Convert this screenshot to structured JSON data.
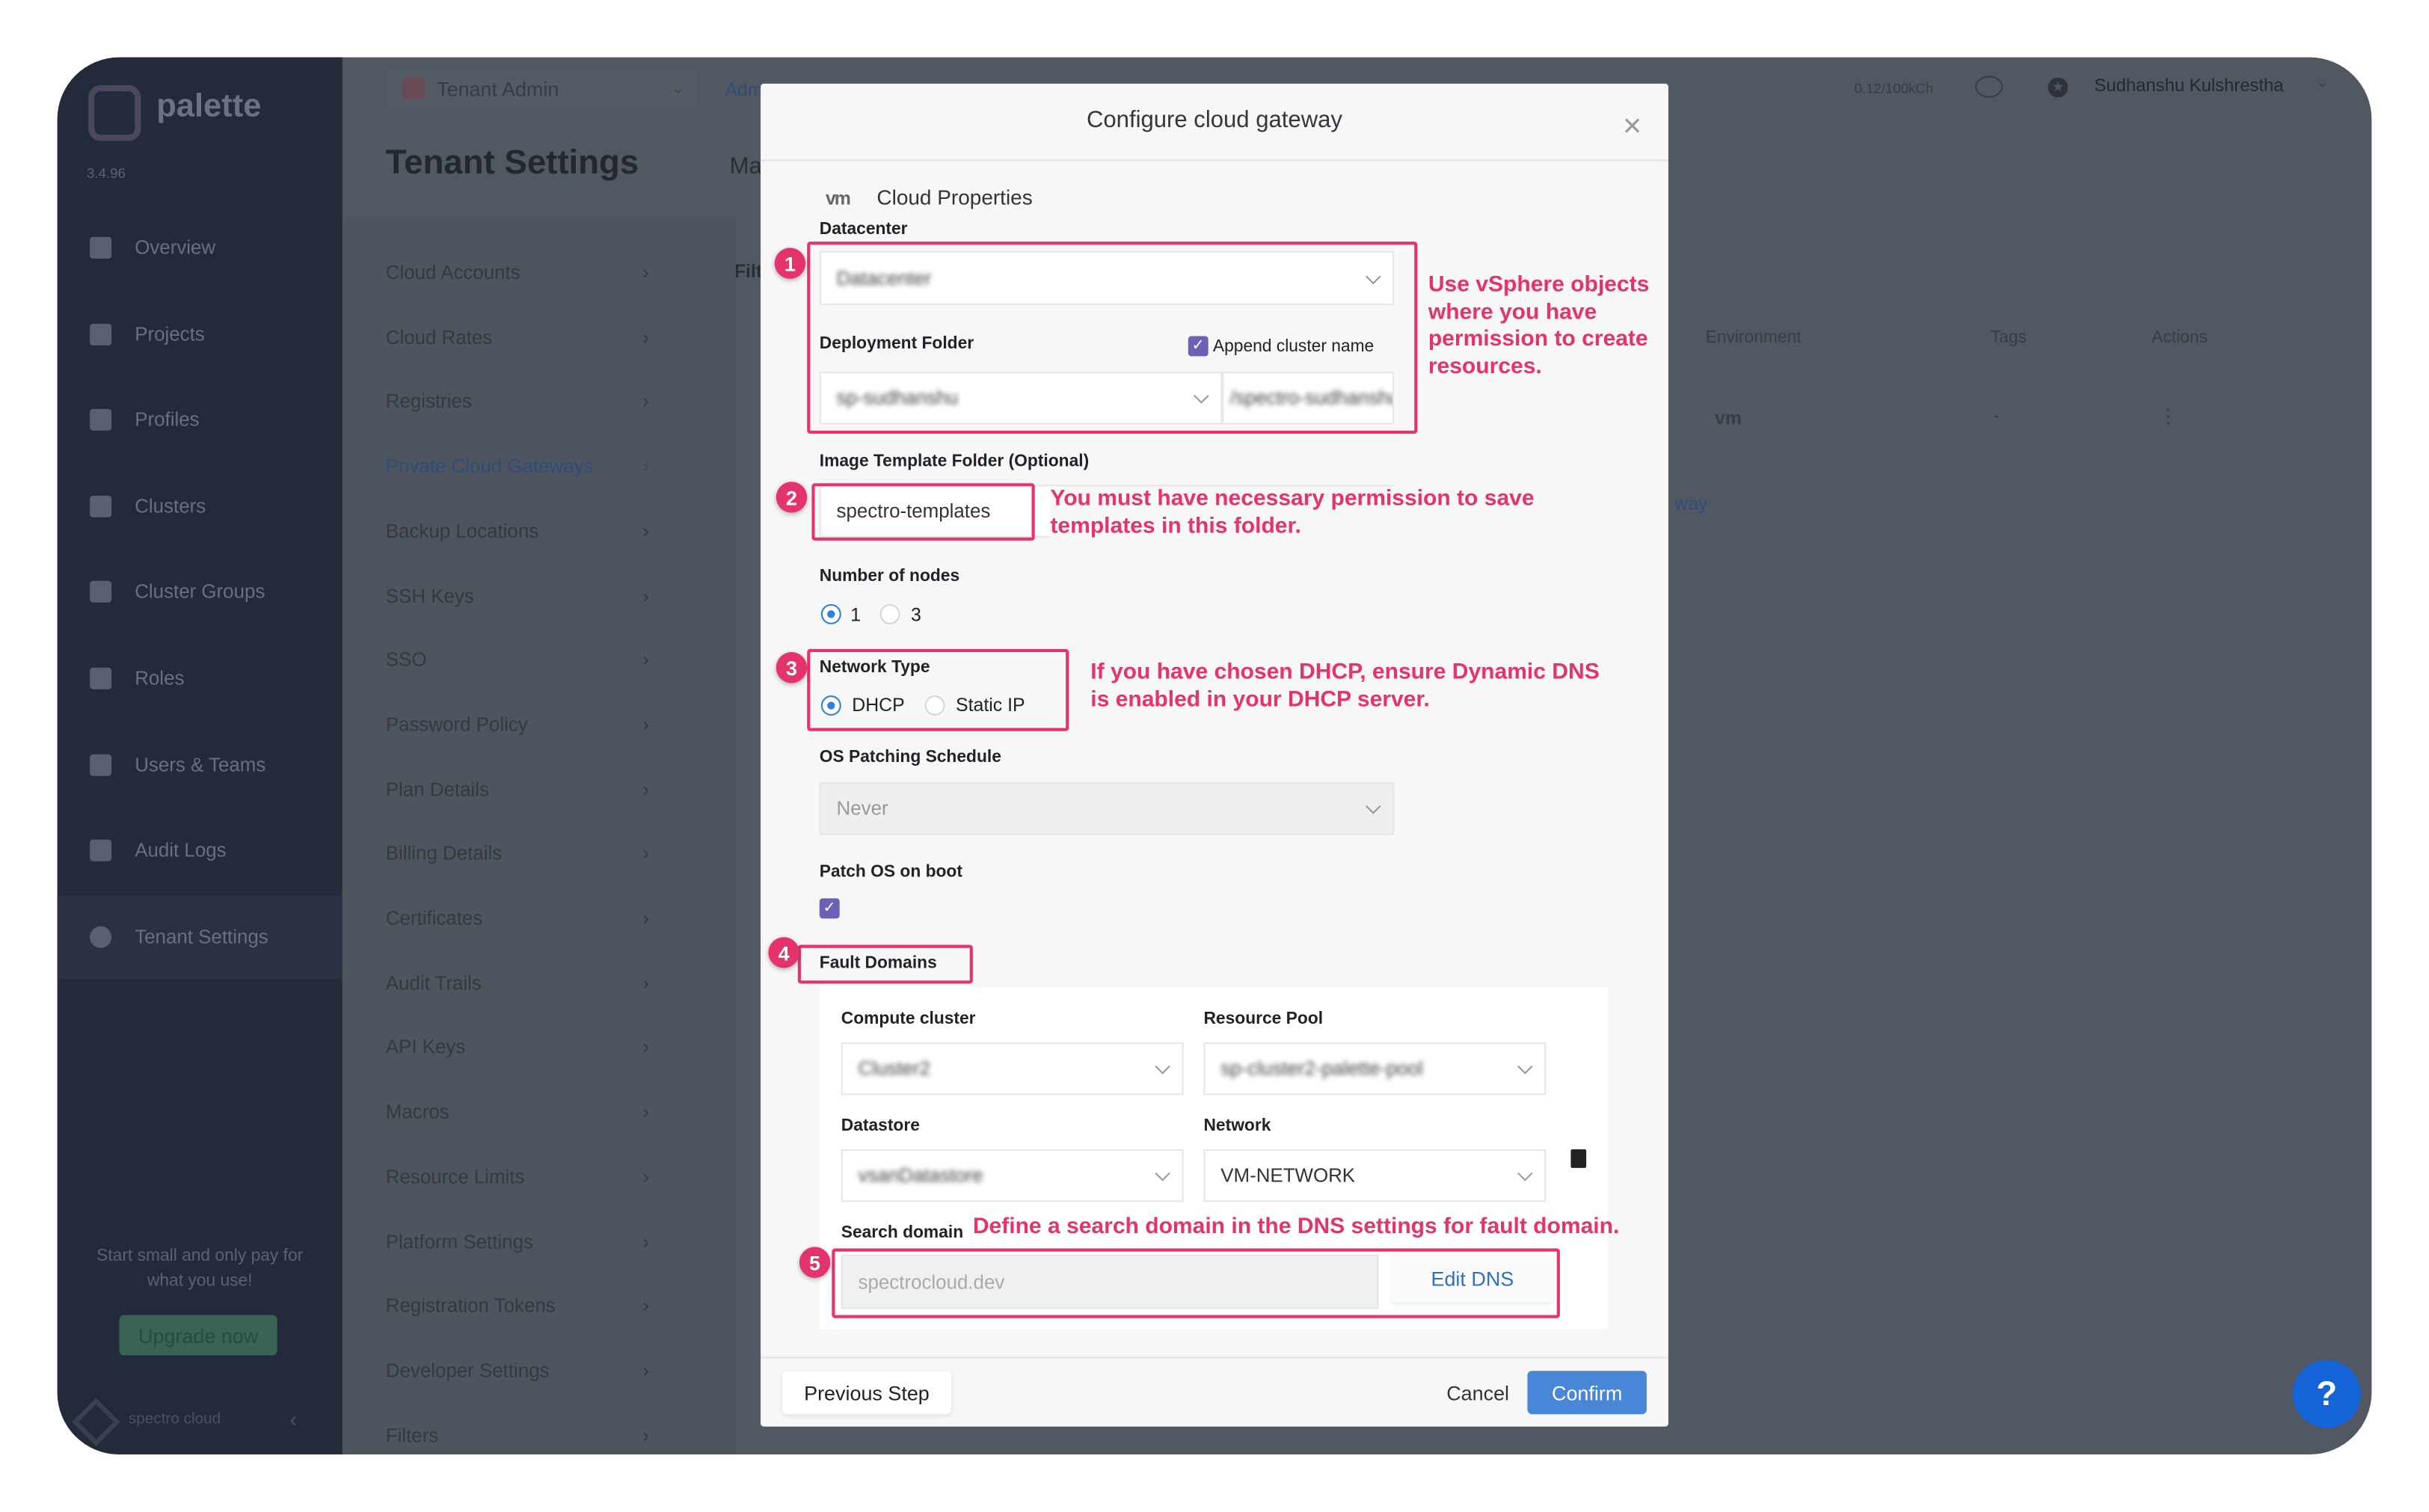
{
  "app": {
    "brand": "palette",
    "version": "3.4.96",
    "footer_brand": "spectro cloud"
  },
  "sidebar": {
    "items": [
      {
        "label": "Overview",
        "icon": "chart-icon"
      },
      {
        "label": "Projects",
        "icon": "projects-icon"
      },
      {
        "label": "Profiles",
        "icon": "stack-icon"
      },
      {
        "label": "Clusters",
        "icon": "server-icon"
      },
      {
        "label": "Cluster Groups",
        "icon": "network-icon"
      },
      {
        "label": "Roles",
        "icon": "user-icon"
      },
      {
        "label": "Users & Teams",
        "icon": "users-icon"
      },
      {
        "label": "Audit Logs",
        "icon": "log-icon"
      },
      {
        "label": "Tenant Settings",
        "icon": "gear-icon",
        "active": true
      }
    ],
    "promo": "Start small and only pay for what you use!",
    "upgrade_label": "Upgrade now"
  },
  "topbar": {
    "scope": "Tenant Admin",
    "breadcrumb_partial": "Adm",
    "usage": "0.12/100kCh",
    "user": "Sudhanshu Kulshrestha"
  },
  "page": {
    "title": "Tenant Settings",
    "section_partial": "Ma",
    "filter_partial": "Filt"
  },
  "settings_menu": [
    "Cloud Accounts",
    "Cloud Rates",
    "Registries",
    "Private Cloud Gateways",
    "Backup Locations",
    "SSH Keys",
    "SSO",
    "Password Policy",
    "Plan Details",
    "Billing Details",
    "Certificates",
    "Audit Trails",
    "API Keys",
    "Macros",
    "Resource Limits",
    "Platform Settings",
    "Registration Tokens",
    "Developer Settings",
    "Filters"
  ],
  "settings_active": "Private Cloud Gateways",
  "table": {
    "headers": [
      "Environment",
      "Tags",
      "Actions"
    ],
    "row": [
      "vm",
      "-",
      "⋮"
    ],
    "partial_text": "way"
  },
  "modal": {
    "title": "Configure cloud gateway",
    "section": "Cloud Properties",
    "vm_logo": "vm",
    "datacenter_label": "Datacenter",
    "datacenter_value": "Datacenter",
    "deployment_folder_label": "Deployment Folder",
    "append_cluster_name_label": "Append cluster name",
    "append_cluster_name_checked": true,
    "deployment_folder_value": "sp-sudhanshu",
    "deployment_suffix_value": "/spectro-sudhanshu...",
    "image_template_label": "Image Template Folder (Optional)",
    "image_template_value": "spectro-templates",
    "nodes_label": "Number of nodes",
    "nodes_options": [
      "1",
      "3"
    ],
    "nodes_selected": "1",
    "network_type_label": "Network Type",
    "network_options": [
      "DHCP",
      "Static IP"
    ],
    "network_selected": "DHCP",
    "os_patch_label": "OS Patching Schedule",
    "os_patch_value": "Never",
    "patch_on_boot_label": "Patch OS on boot",
    "patch_on_boot_checked": true,
    "fault_domains_label": "Fault Domains",
    "compute_cluster_label": "Compute cluster",
    "compute_cluster_value": "Cluster2",
    "resource_pool_label": "Resource Pool",
    "resource_pool_value": "sp-cluster2-palette-pool",
    "datastore_label": "Datastore",
    "datastore_value": "vsanDatastore",
    "network_label": "Network",
    "network_value": "VM-NETWORK",
    "search_domain_label": "Search domain",
    "search_domain_value": "spectrocloud.dev",
    "edit_dns_label": "Edit DNS",
    "previous_label": "Previous Step",
    "cancel_label": "Cancel",
    "confirm_label": "Confirm"
  },
  "annotations": {
    "badges": [
      "1",
      "2",
      "3",
      "4",
      "5"
    ],
    "note1": "Use vSphere objects where you have permission to create resources.",
    "note2": "You must have necessary permission to save templates in this folder.",
    "note3": "If you have chosen DHCP, ensure Dynamic DNS is enabled in your DHCP server.",
    "note5": "Define a search domain in the DNS settings for fault domain.",
    "color": "#e5336b"
  },
  "help_label": "?",
  "colors": {
    "accent": "#4a86d8",
    "sidebar": "#232a3a",
    "annotation": "#e5336b"
  }
}
